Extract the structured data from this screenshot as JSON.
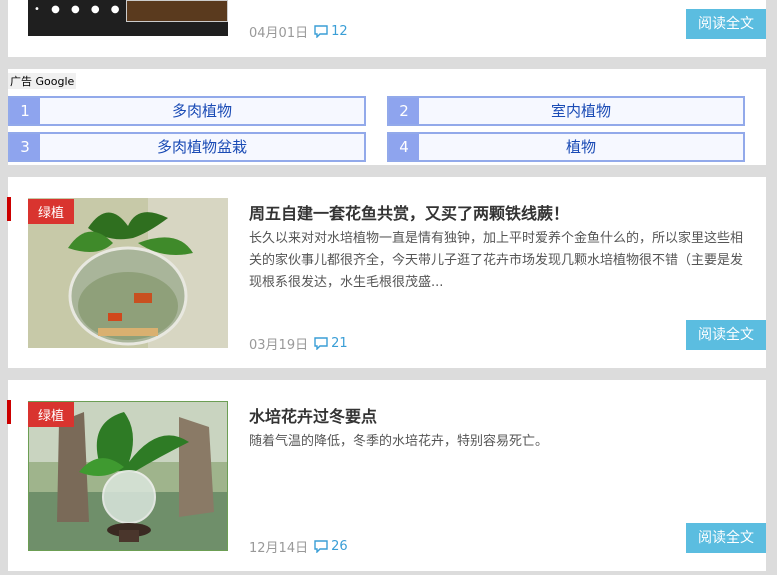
{
  "post0": {
    "date": "04月01日",
    "comments": "12",
    "read_more": "阅读全文"
  },
  "ads": {
    "label": "广告 Google",
    "items": [
      {
        "num": "1",
        "text": "多肉植物"
      },
      {
        "num": "2",
        "text": "室内植物"
      },
      {
        "num": "3",
        "text": "多肉植物盆栽"
      },
      {
        "num": "4",
        "text": "植物"
      }
    ]
  },
  "post1": {
    "tag": "绿植",
    "title": "周五自建一套花鱼共赏，又买了两颗铁线蕨！",
    "desc": "长久以来对对水培植物一直是情有独钟，加上平时爱养个金鱼什么的，所以家里这些相关的家伙事儿都很齐全，今天带儿子逛了花卉市场发现几颗水培植物很不错（主要是发现根系很发达，水生毛根很茂盛...",
    "date": "03月19日",
    "comments": "21",
    "read_more": "阅读全文"
  },
  "post2": {
    "tag": "绿植",
    "title": "水培花卉过冬要点",
    "desc": "随着气温的降低，冬季的水培花卉，特别容易死亡。",
    "date": "12月14日",
    "comments": "26",
    "read_more": "阅读全文"
  }
}
